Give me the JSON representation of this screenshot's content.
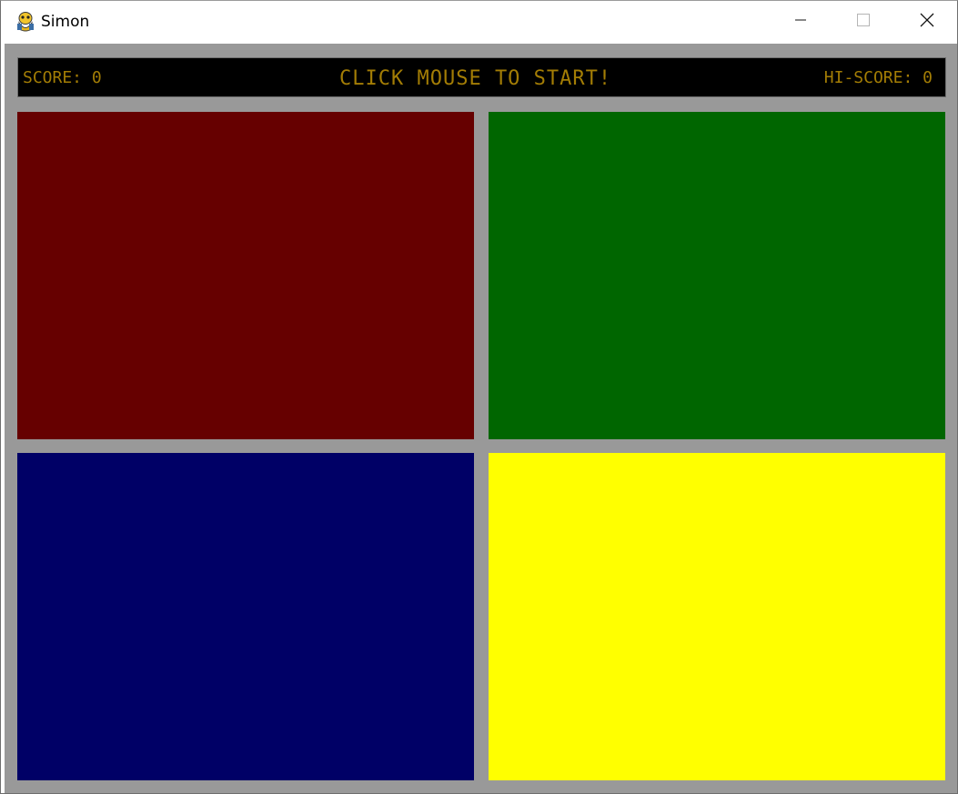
{
  "window": {
    "title": "Simon",
    "controls": {
      "minimize": "minimize-icon",
      "maximize": "maximize-icon",
      "close": "close-icon"
    }
  },
  "game": {
    "score_label": "SCORE: 0",
    "message": "CLICK MOUSE TO START!",
    "hiscore_label": "HI-SCORE: 0",
    "text_color": "#a37d05",
    "pads": [
      {
        "name": "red",
        "color": "#660000"
      },
      {
        "name": "green",
        "color": "#006600"
      },
      {
        "name": "blue",
        "color": "#000066"
      },
      {
        "name": "yellow",
        "color": "#ffff00"
      }
    ]
  }
}
